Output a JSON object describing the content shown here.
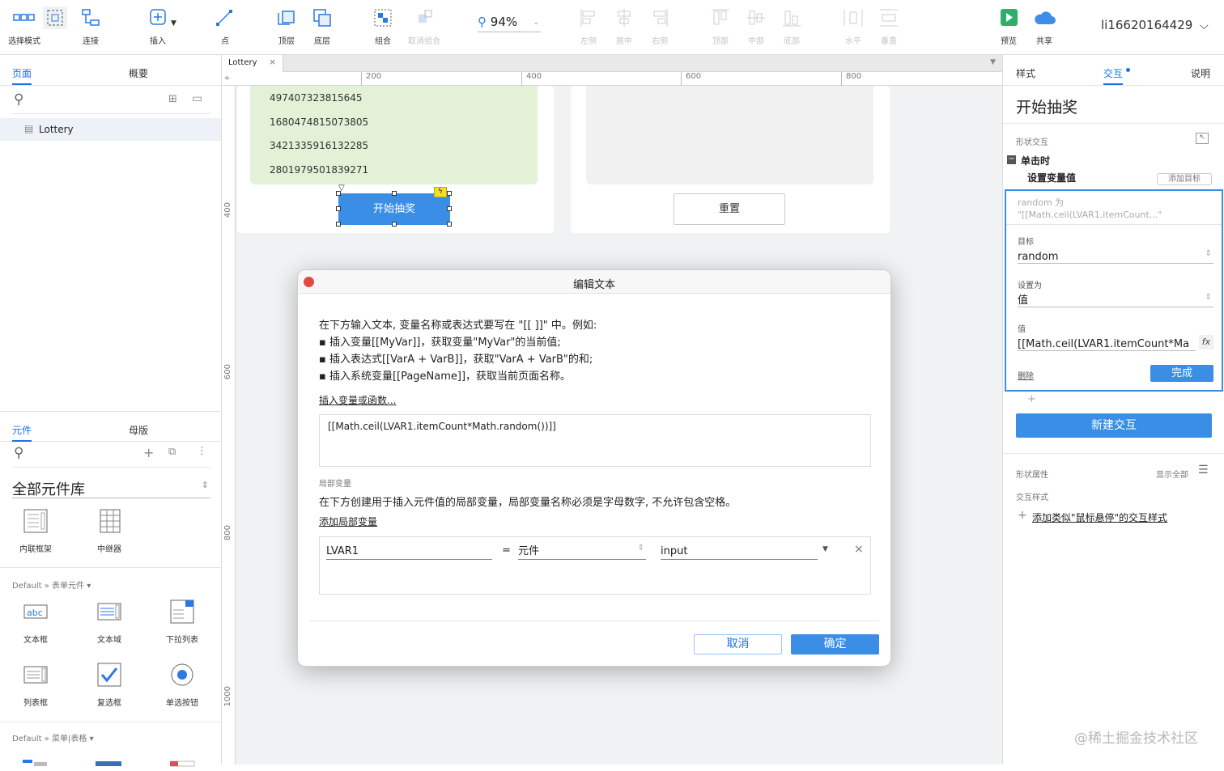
{
  "toolbar": {
    "items": [
      {
        "label": "选择模式",
        "icon": "select-mode-icon"
      },
      {
        "label": "连接",
        "icon": "connect-icon"
      },
      {
        "label": "插入",
        "icon": "insert-icon"
      },
      {
        "label": "点",
        "icon": "point-icon"
      },
      {
        "label": "顶层",
        "icon": "bring-front-icon"
      },
      {
        "label": "底层",
        "icon": "send-back-icon"
      },
      {
        "label": "组合",
        "icon": "group-icon"
      },
      {
        "label": "取消组合",
        "icon": "ungroup-icon"
      },
      {
        "label": "左侧",
        "icon": "align-left-icon"
      },
      {
        "label": "居中",
        "icon": "align-center-icon"
      },
      {
        "label": "右侧",
        "icon": "align-right-icon"
      },
      {
        "label": "顶部",
        "icon": "align-top-icon"
      },
      {
        "label": "中部",
        "icon": "align-middle-icon"
      },
      {
        "label": "底部",
        "icon": "align-bottom-icon"
      },
      {
        "label": "水平",
        "icon": "distribute-horizontal-icon"
      },
      {
        "label": "垂直",
        "icon": "distribute-vertical-icon"
      },
      {
        "label": "预览",
        "icon": "preview-icon"
      },
      {
        "label": "共享",
        "icon": "share-cloud-icon"
      }
    ],
    "zoom": "94%",
    "user": "li16620164429"
  },
  "left": {
    "tabs": [
      "页面",
      "概要"
    ],
    "page_item": "Lottery",
    "lib_tabs": [
      "元件",
      "母版"
    ],
    "library_name": "全部元件库",
    "row1": [
      "内联框架",
      "中继器"
    ],
    "section_form": "Default » 表单元件",
    "form_items": [
      "文本框",
      "文本域",
      "下拉列表",
      "列表框",
      "复选框",
      "单选按钮"
    ],
    "section_menu": "Default » 菜单|表格"
  },
  "canvas": {
    "tab": "Lottery",
    "ruler": [
      "200",
      "400",
      "600",
      "800"
    ],
    "vruler": [
      "400",
      "600",
      "800",
      "1000"
    ],
    "numbers": [
      "497407323815645",
      "1680474815073805",
      "3421335916132285",
      "2801979501839271"
    ],
    "start_button": "开始抽奖",
    "reset_button": "重置"
  },
  "dialog": {
    "title": "编辑文本",
    "intro": "在下方输入文本, 变量名称或表达式要写在 \"[[ ]]\" 中。例如:",
    "bullet1": "▪ 插入变量[[MyVar]]，获取变量\"MyVar\"的当前值;",
    "bullet2": "▪ 插入表达式[[VarA + VarB]]，获取\"VarA + VarB\"的和;",
    "bullet3": "▪ 插入系统变量[[PageName]]，获取当前页面名称。",
    "insert_link": "插入变量或函数...",
    "expression": "[[Math.ceil(LVAR1.itemCount*Math.random())]]",
    "local_label": "局部变量",
    "local_desc": "在下方创建用于插入元件值的局部变量，局部变量名称必须是字母数字, 不允许包含空格。",
    "add_local": "添加局部变量",
    "var_name": "LVAR1",
    "equals": "=",
    "var_type": "元件",
    "var_target": "input",
    "cancel": "取消",
    "ok": "确定"
  },
  "right": {
    "tabs": [
      "样式",
      "交互",
      "说明"
    ],
    "title": "开始抽奖",
    "shape_interaction": "形状交互",
    "event": "单击时",
    "action": "设置变量值",
    "add_target": "添加目标",
    "summary1": "random 为",
    "summary2": "\"[[Math.ceil(LVAR1.itemCount...\"",
    "target_label": "目标",
    "target_value": "random",
    "setto_label": "设置为",
    "setto_value": "值",
    "value_label": "值",
    "value_text": "[[Math.ceil(LVAR1.itemCount*Ma",
    "delete": "删除",
    "done": "完成",
    "new_interaction": "新建交互",
    "shape_props": "形状属性",
    "show_all": "显示全部",
    "interaction_style": "交互样式",
    "add_style": "添加类似\"鼠标悬停\"的交互样式",
    "watermark": "@稀土掘金技术社区"
  }
}
